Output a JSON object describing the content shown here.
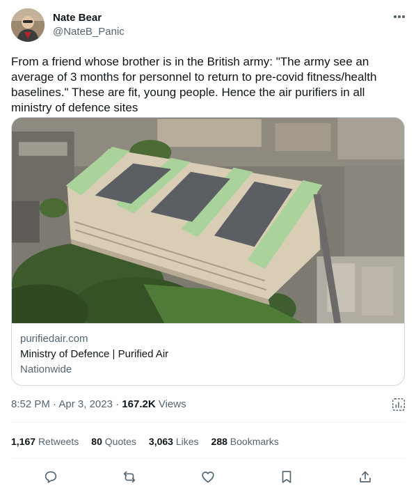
{
  "author": {
    "name": "Nate Bear",
    "handle": "@NateB_Panic"
  },
  "tweet": {
    "text": "From a friend whose brother is in the British army: \"The army see an average of 3 months for personnel to return to pre-covid fitness/health baselines.\" These are fit, young people. Hence the air purifiers in all ministry of defence sites"
  },
  "card": {
    "domain": "purifiedair.com",
    "title": "Ministry of Defence | Purified Air",
    "description": "Nationwide",
    "image_subject": "aerial-photo-ministry-of-defence-building"
  },
  "meta": {
    "time": "8:52 PM",
    "separator": "·",
    "date": "Apr 3, 2023",
    "views_count": "167.2K",
    "views_label": "Views"
  },
  "stats": {
    "retweets_count": "1,167",
    "retweets_label": "Retweets",
    "quotes_count": "80",
    "quotes_label": "Quotes",
    "likes_count": "3,063",
    "likes_label": "Likes",
    "bookmarks_count": "288",
    "bookmarks_label": "Bookmarks"
  },
  "icons": {
    "more": "more-horizontal-icon",
    "analytics": "analytics-icon",
    "reply": "reply-icon",
    "retweet": "retweet-icon",
    "like": "heart-icon",
    "bookmark": "bookmark-icon",
    "share": "share-icon"
  },
  "colors": {
    "text": "#0f1419",
    "secondary": "#536471",
    "border": "#cfd9de"
  }
}
